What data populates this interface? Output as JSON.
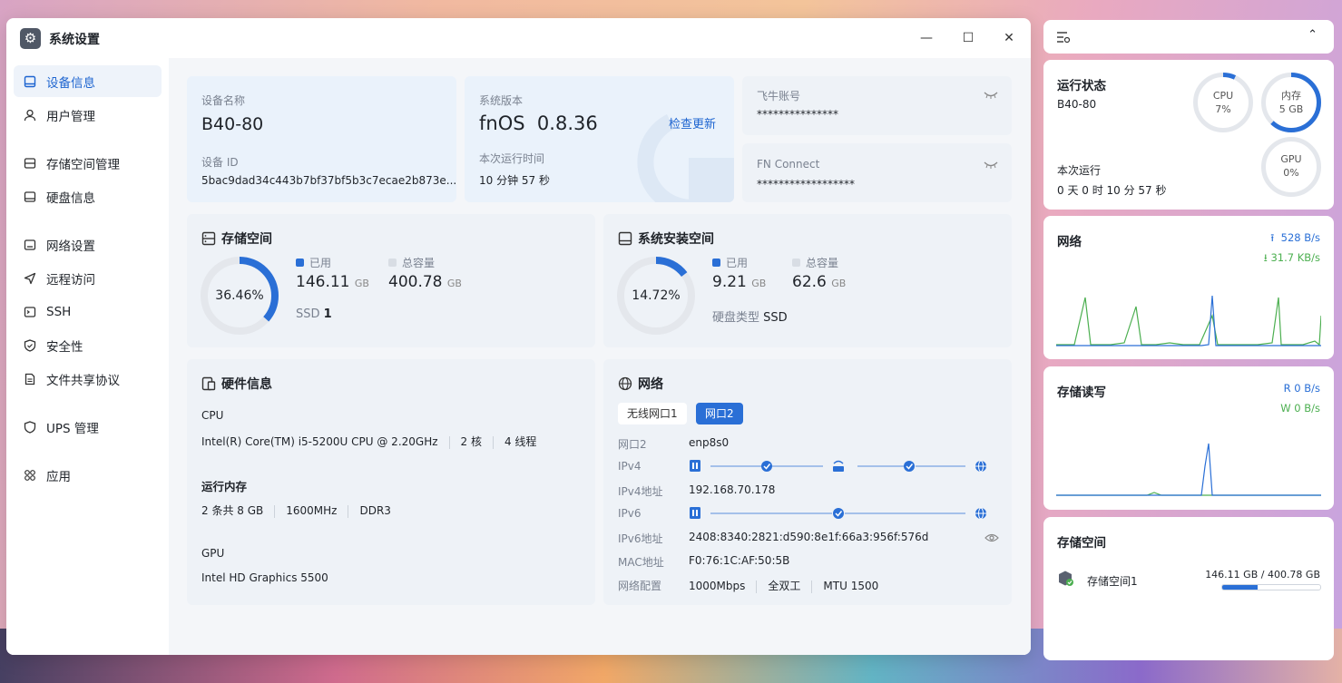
{
  "window": {
    "title": "系统设置"
  },
  "sidebar": {
    "items": [
      {
        "label": "设备信息",
        "icon": "device-icon"
      },
      {
        "label": "用户管理",
        "icon": "user-icon"
      },
      {
        "label": "存储空间管理",
        "icon": "storage-icon"
      },
      {
        "label": "硬盘信息",
        "icon": "disk-icon"
      },
      {
        "label": "网络设置",
        "icon": "network-icon"
      },
      {
        "label": "远程访问",
        "icon": "send-icon"
      },
      {
        "label": "SSH",
        "icon": "terminal-icon"
      },
      {
        "label": "安全性",
        "icon": "shield-icon"
      },
      {
        "label": "文件共享协议",
        "icon": "file-icon"
      },
      {
        "label": "UPS 管理",
        "icon": "power-shield-icon"
      },
      {
        "label": "应用",
        "icon": "apps-icon"
      }
    ]
  },
  "device": {
    "name_label": "设备名称",
    "name": "B40-80",
    "id_label": "设备 ID",
    "id": "5bac9dad34c443b7bf37bf5b3c7ecae2b873e..."
  },
  "version": {
    "label": "系统版本",
    "os": "fnOS",
    "number": "0.8.36",
    "check_update": "检查更新",
    "uptime_label": "本次运行时间",
    "uptime": "10 分钟 57 秒"
  },
  "accounts": {
    "feiniu_label": "飞牛账号",
    "feiniu_value": "***************",
    "fnconnect_label": "FN Connect",
    "fnconnect_value": "******************"
  },
  "storage": {
    "title": "存储空间",
    "percent_text": "36.46%",
    "percent": 36.46,
    "used_label": "已用",
    "used": "146.11",
    "used_unit": "GB",
    "total_label": "总容量",
    "total": "400.78",
    "total_unit": "GB",
    "ssd_label": "SSD",
    "ssd_count": "1"
  },
  "system_storage": {
    "title": "系统安装空间",
    "percent_text": "14.72%",
    "percent": 14.72,
    "used_label": "已用",
    "used": "9.21",
    "used_unit": "GB",
    "total_label": "总容量",
    "total": "62.6",
    "total_unit": "GB",
    "disk_type_label": "硬盘类型",
    "disk_type": "SSD"
  },
  "hardware": {
    "title": "硬件信息",
    "cpu_label": "CPU",
    "cpu_model": "Intel(R) Core(TM) i5-5200U CPU @ 2.20GHz",
    "cpu_cores": "2 核",
    "cpu_threads": "4 线程",
    "mem_label": "运行内存",
    "mem_size": "2 条共 8 GB",
    "mem_freq": "1600MHz",
    "mem_type": "DDR3",
    "gpu_label": "GPU",
    "gpu_model": "Intel HD Graphics 5500"
  },
  "network": {
    "title": "网络",
    "tabs": [
      "无线网口1",
      "网口2"
    ],
    "active_tab": 1,
    "rows": {
      "port_label": "网口2",
      "port_value": "enp8s0",
      "ipv4_label": "IPv4",
      "ipv4_addr_label": "IPv4地址",
      "ipv4_addr": "192.168.70.178",
      "ipv6_label": "IPv6",
      "ipv6_addr_label": "IPv6地址",
      "ipv6_addr": "2408:8340:2821:d590:8e1f:66a3:956f:576d",
      "mac_label": "MAC地址",
      "mac": "F0:76:1C:AF:50:5B",
      "config_label": "网络配置",
      "speed": "1000Mbps",
      "duplex": "全双工",
      "mtu": "MTU 1500"
    }
  },
  "widgets": {
    "status": {
      "title": "运行状态",
      "device": "B40-80",
      "cpu_label": "CPU",
      "cpu_value": "7%",
      "cpu_percent": 7,
      "mem_label": "内存",
      "mem_value": "5 GB",
      "mem_percent": 62,
      "gpu_label": "GPU",
      "gpu_value": "0%",
      "gpu_percent": 0,
      "uptime_label": "本次运行",
      "uptime": "0 天 0 时 10 分 57 秒"
    },
    "network": {
      "title": "网络",
      "upload": "528 B/s",
      "download": "31.7 KB/s"
    },
    "disk_io": {
      "title": "存储读写",
      "read": "R 0 B/s",
      "write": "W 0 B/s"
    },
    "storage": {
      "title": "存储空间",
      "volume": "存储空间1",
      "usage": "146.11 GB / 400.78 GB",
      "percent": 36.46
    }
  },
  "colors": {
    "accent": "#2a6fd6",
    "green": "#4caf50",
    "ring_bg": "#e4e7ec"
  }
}
